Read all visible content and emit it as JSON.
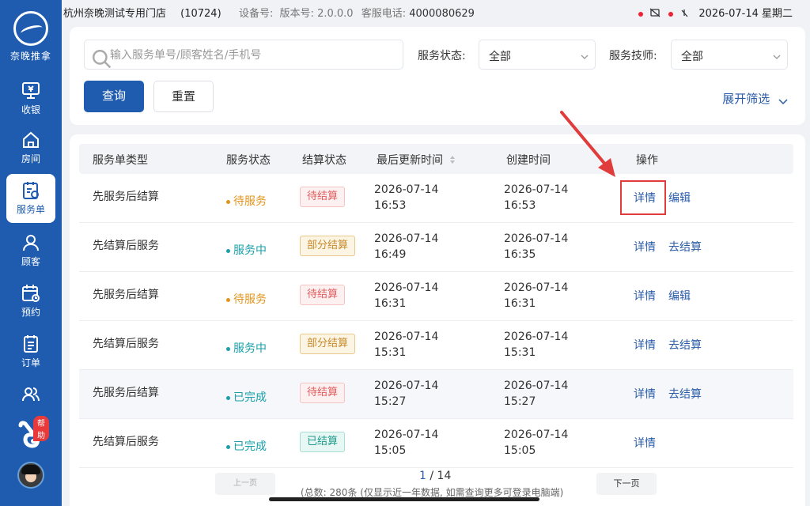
{
  "sidebar": {
    "logo_text": "奈晚推拿",
    "items": [
      {
        "label": "收银",
        "icon": "cashier-icon"
      },
      {
        "label": "房间",
        "icon": "home-icon"
      },
      {
        "label": "服务单",
        "icon": "service-order-icon",
        "active": true
      },
      {
        "label": "顾客",
        "icon": "customer-icon"
      },
      {
        "label": "预约",
        "icon": "calendar-icon"
      },
      {
        "label": "订单",
        "icon": "order-icon"
      },
      {
        "label": "",
        "icon": "users-icon"
      }
    ],
    "help_label": "帮助"
  },
  "statusbar": {
    "store_name": "杭州奈晚测试专用门店",
    "store_code": "(10724)",
    "device_label": "设备号:",
    "version_label": "版本号:",
    "version": "2.0.0.0",
    "service_phone_label": "客服电话:",
    "service_phone": "4000080629",
    "datetime": "2026-07-14 星期二"
  },
  "filters": {
    "search_placeholder": "输入服务单号/顾客姓名/手机号",
    "service_status_label": "服务状态:",
    "service_status_value": "全部",
    "technician_label": "服务技师:",
    "technician_value": "全部",
    "query_button": "查询",
    "reset_button": "重置",
    "expand_label": "展开筛选"
  },
  "table": {
    "headers": [
      "服务单类型",
      "服务状态",
      "结算状态",
      "最后更新时间",
      "创建时间",
      "操作"
    ],
    "rows": [
      {
        "type": "先服务后结算",
        "status": "待服务",
        "status_kind": "wait",
        "settle": "待结算",
        "settle_kind": "unsettled",
        "updated_date": "2026-07-14",
        "updated_time": "16:53",
        "created_date": "2026-07-14",
        "created_time": "16:53",
        "op1": "详情",
        "op2": "编辑"
      },
      {
        "type": "先结算后服务",
        "status": "服务中",
        "status_kind": "serv",
        "settle": "部分结算",
        "settle_kind": "partial",
        "updated_date": "2026-07-14",
        "updated_time": "16:49",
        "created_date": "2026-07-14",
        "created_time": "16:35",
        "op1": "详情",
        "op2": "去结算"
      },
      {
        "type": "先服务后结算",
        "status": "待服务",
        "status_kind": "wait",
        "settle": "待结算",
        "settle_kind": "unsettled",
        "updated_date": "2026-07-14",
        "updated_time": "16:31",
        "created_date": "2026-07-14",
        "created_time": "16:31",
        "op1": "详情",
        "op2": "编辑"
      },
      {
        "type": "先结算后服务",
        "status": "服务中",
        "status_kind": "serv",
        "settle": "部分结算",
        "settle_kind": "partial",
        "updated_date": "2026-07-14",
        "updated_time": "15:31",
        "created_date": "2026-07-14",
        "created_time": "15:31",
        "op1": "详情",
        "op2": "去结算"
      },
      {
        "type": "先服务后结算",
        "status": "已完成",
        "status_kind": "done",
        "settle": "待结算",
        "settle_kind": "unsettled",
        "updated_date": "2026-07-14",
        "updated_time": "15:27",
        "created_date": "2026-07-14",
        "created_time": "15:27",
        "op1": "详情",
        "op2": "去结算"
      },
      {
        "type": "先结算后服务",
        "status": "已完成",
        "status_kind": "done",
        "settle": "已结算",
        "settle_kind": "settled",
        "updated_date": "2026-07-14",
        "updated_time": "15:05",
        "created_date": "2026-07-14",
        "created_time": "15:05",
        "op1": "详情",
        "op2": ""
      }
    ]
  },
  "pagination": {
    "prev_label": "上一页",
    "next_label": "下一页",
    "current_page": "1",
    "page_separator": "/",
    "total_pages": "14",
    "total_note": "(总数: 280条 (仅显示近一年数据, 如需查询更多可登录电脑端)"
  },
  "colors": {
    "primary": "#1f5cb0",
    "link": "#2a5ca8",
    "annotation": "#e03c3c"
  }
}
